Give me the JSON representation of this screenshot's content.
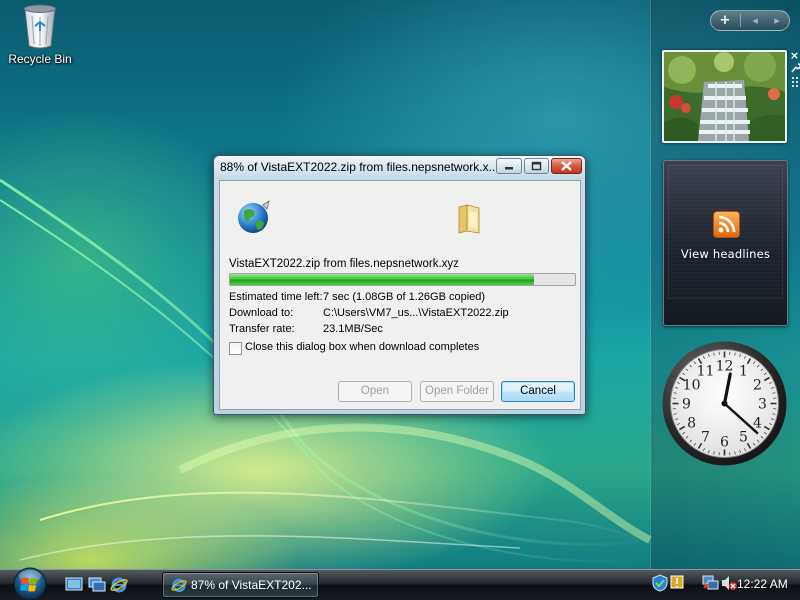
{
  "desktop": {
    "icons": [
      {
        "label": "Recycle Bin",
        "icon": "recycle-bin-icon"
      }
    ]
  },
  "sidebar": {
    "controls": {
      "add": "+",
      "prev": "◂",
      "next": "▸"
    },
    "gadget_toolbar": {
      "close": "×",
      "options": "wrench",
      "drag": "grip"
    },
    "slideshow": {
      "subject": "waterfall-photo"
    },
    "feed": {
      "link": "View headlines",
      "icon": "rss-feed-icon"
    },
    "clock": {
      "hour": 12,
      "minute": 22,
      "numerals": [
        "12",
        "1",
        "2",
        "3",
        "4",
        "5",
        "6",
        "7",
        "8",
        "9",
        "10",
        "11"
      ]
    }
  },
  "dialog": {
    "title": "88% of VistaEXT2022.zip from files.nepsnetwork.xyz",
    "title_display": "88% of VistaEXT2022.zip from files.nepsnetwork.x...",
    "file_line": "VistaEXT2022.zip from files.nepsnetwork.xyz",
    "progress": 0.88,
    "rows": [
      {
        "label": "Estimated time left:",
        "value": "7 sec (1.08GB of 1.26GB copied)"
      },
      {
        "label": "Download to:",
        "value": "C:\\Users\\VM7_us...\\VistaEXT2022.zip"
      },
      {
        "label": "Transfer rate:",
        "value": "23.1MB/Sec"
      }
    ],
    "checkbox": {
      "label": "Close this dialog box when download completes",
      "checked": false
    },
    "buttons": {
      "open": "Open",
      "open_folder": "Open Folder",
      "cancel": "Cancel"
    }
  },
  "taskbar": {
    "start": "start-orb",
    "quick_launch": [
      "show-desktop-icon",
      "switch-windows-icon",
      "internet-explorer-icon"
    ],
    "task": {
      "label": "87% of VistaEXT202...",
      "icon": "internet-explorer-icon"
    },
    "tray_icons": [
      "security-center-icon",
      "network-icon",
      "volume-muted-icon"
    ],
    "clock": "12:22 AM"
  },
  "colors": {
    "progress": "#3fc436",
    "close_button": "#d8583c",
    "cancel_button": "#bee6fd"
  }
}
